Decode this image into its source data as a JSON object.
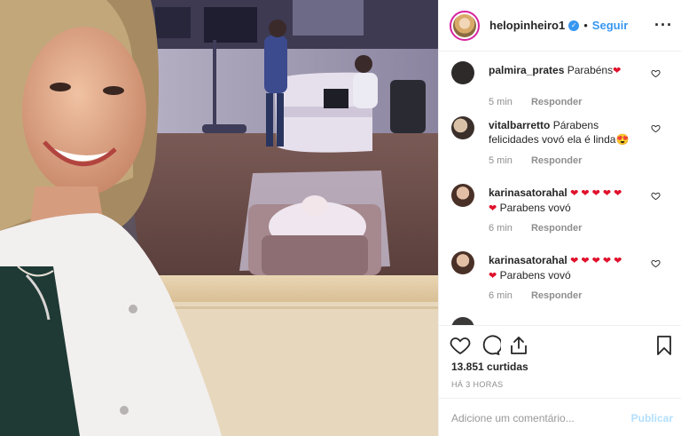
{
  "post": {
    "username": "helopinheiro1",
    "separator": "•",
    "follow_label": "Seguir",
    "more_icon": "more-horizontal-icon"
  },
  "comments": [
    {
      "user": "palmira_prates",
      "text": "Parabéns",
      "hearts": 1,
      "time": "5 min",
      "reply": "Responder"
    },
    {
      "user": "vitalbarretto",
      "text": "Párabens felicidades vovó ela é linda",
      "emoji": "heart-eyes-emoji",
      "time": "5 min",
      "reply": "Responder"
    },
    {
      "user": "karinasatorahal",
      "hearts_line1": 5,
      "text": "Parabens vovó",
      "time": "6 min",
      "reply": "Responder"
    },
    {
      "user": "karinasatorahal",
      "hearts_line1": 5,
      "text": "Parabens vovó",
      "time": "6 min",
      "reply": "Responder"
    }
  ],
  "actions": {
    "like_icon": "heart-outline-icon",
    "comment_icon": "comment-bubble-icon",
    "share_icon": "share-icon",
    "save_icon": "bookmark-icon",
    "likes": "13.851 curtidas",
    "time_ago": "HÁ 3 HORAS"
  },
  "composer": {
    "placeholder": "Adicione um comentário...",
    "publish_label": "Publicar"
  },
  "colors": {
    "link": "#3897f0",
    "heart_red": "#e0102b",
    "muted": "#8e8e8e",
    "publish_disabled": "#b2dffc"
  }
}
